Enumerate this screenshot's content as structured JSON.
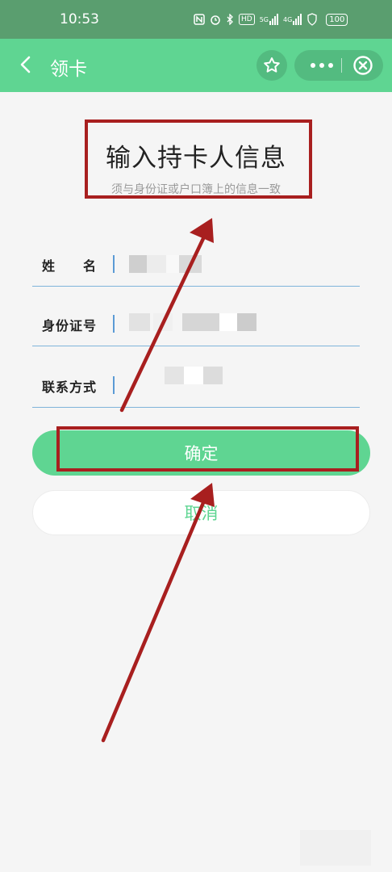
{
  "status_bar": {
    "time": "10:53",
    "network_label": "5G",
    "network_label_2": "4G",
    "hd_label": "HD",
    "battery": "100"
  },
  "nav": {
    "title": "领卡",
    "back_icon": "chevron-left-icon",
    "star_icon": "star-icon",
    "more_icon": "more-dots-icon",
    "close_icon": "close-circle-icon"
  },
  "form": {
    "heading": "输入持卡人信息",
    "subheading": "须与身份证或户口簿上的信息一致",
    "fields": [
      {
        "label": "姓　　名",
        "value": ""
      },
      {
        "label": "身份证号",
        "value": ""
      },
      {
        "label": "联系方式",
        "value": ""
      }
    ],
    "confirm_label": "确定",
    "cancel_label": "取消"
  },
  "colors": {
    "status_bar": "#5a9e6f",
    "nav_bar": "#5fd592",
    "accent": "#5fd592",
    "annotation": "#a81f1f",
    "underline": "#7fb4da"
  }
}
